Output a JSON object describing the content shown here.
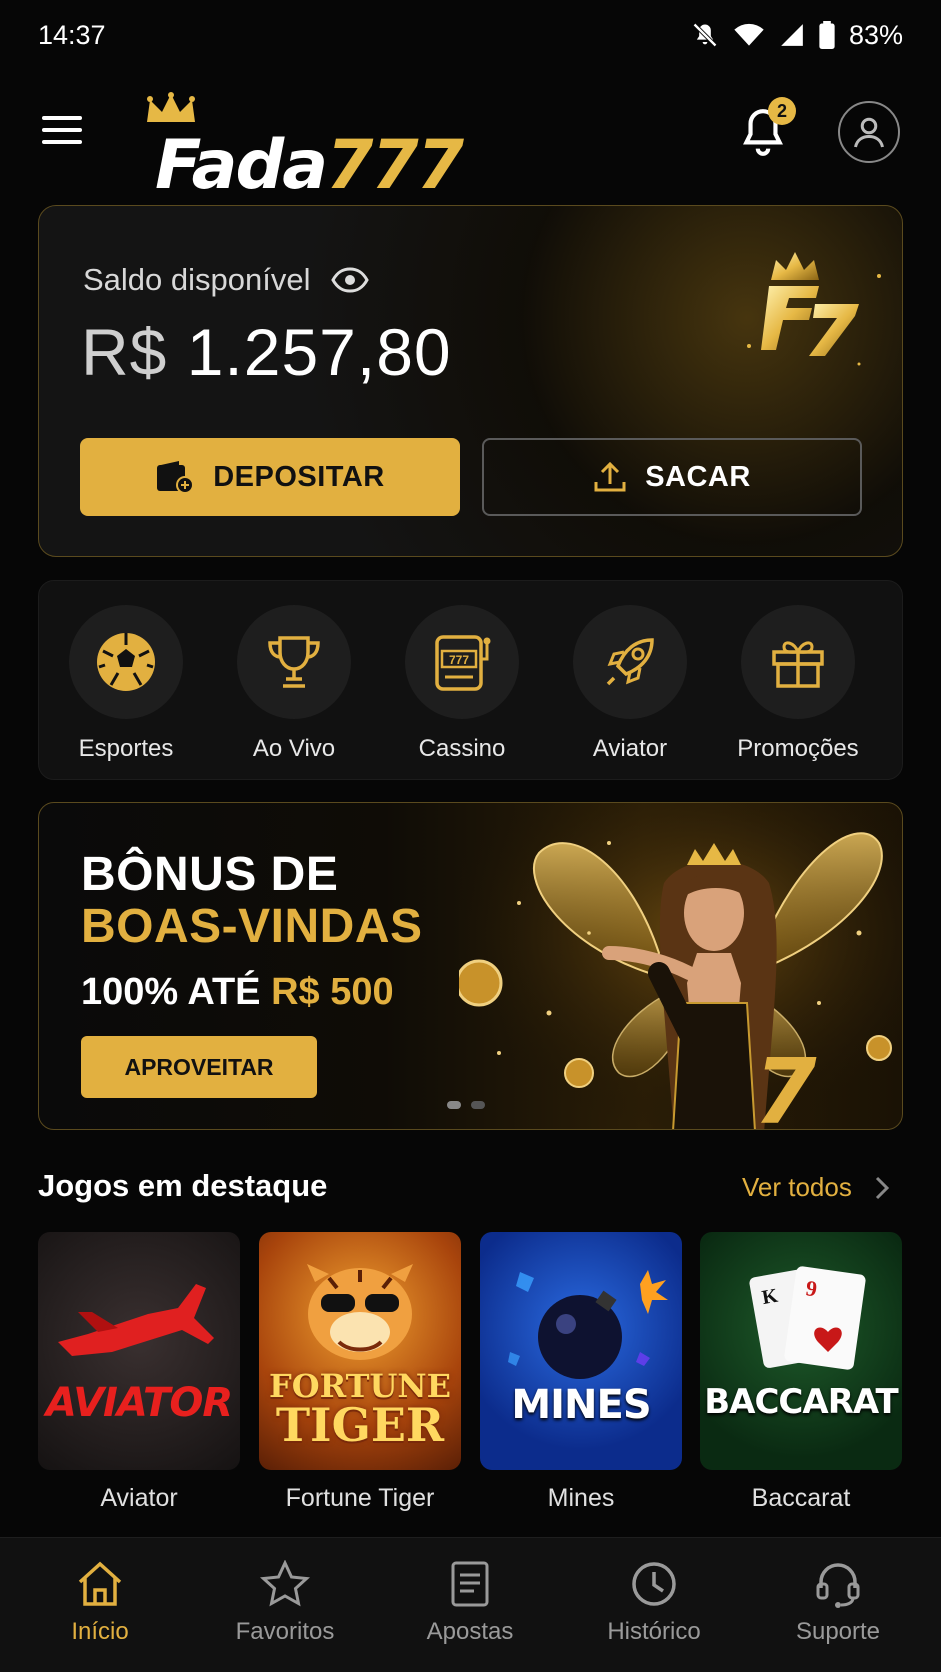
{
  "status_bar": {
    "time": "14:37",
    "battery": "83%"
  },
  "header": {
    "logo_word": "Fada",
    "logo_num": "777",
    "notifications": "2"
  },
  "balance": {
    "label": "Saldo disponível",
    "currency": "R$",
    "amount": "1.257,80",
    "deposit_label": "DEPOSITAR",
    "withdraw_label": "SACAR"
  },
  "categories": [
    {
      "label": "Esportes",
      "icon": "soccer-ball-icon"
    },
    {
      "label": "Ao Vivo",
      "icon": "trophy-icon"
    },
    {
      "label": "Cassino",
      "icon": "slot-machine-icon"
    },
    {
      "label": "Aviator",
      "icon": "rocket-icon"
    },
    {
      "label": "Promoções",
      "icon": "gift-icon"
    }
  ],
  "banner": {
    "line1": "BÔNUS DE",
    "line2": "BOAS-VINDAS",
    "line3_a": "100% ATÉ",
    "line3_b": "R$ 500",
    "cta": "APROVEITAR"
  },
  "featured": {
    "title": "Jogos em destaque",
    "see_all": "Ver todos",
    "games": [
      {
        "name": "Aviator",
        "art": "AVIATOR"
      },
      {
        "name": "Fortune Tiger",
        "art_1": "FORTUNE",
        "art_2": "TIGER"
      },
      {
        "name": "Mines",
        "art": "MINES"
      },
      {
        "name": "Baccarat",
        "art": "BACCARAT"
      }
    ]
  },
  "bottom_nav": [
    {
      "label": "Início",
      "icon": "home-icon",
      "active": true
    },
    {
      "label": "Favoritos",
      "icon": "star-icon"
    },
    {
      "label": "Apostas",
      "icon": "ticket-icon"
    },
    {
      "label": "Histórico",
      "icon": "clock-icon"
    },
    {
      "label": "Suporte",
      "icon": "headset-icon"
    }
  ],
  "colors": {
    "accent": "#e2b040",
    "background": "#060606"
  }
}
